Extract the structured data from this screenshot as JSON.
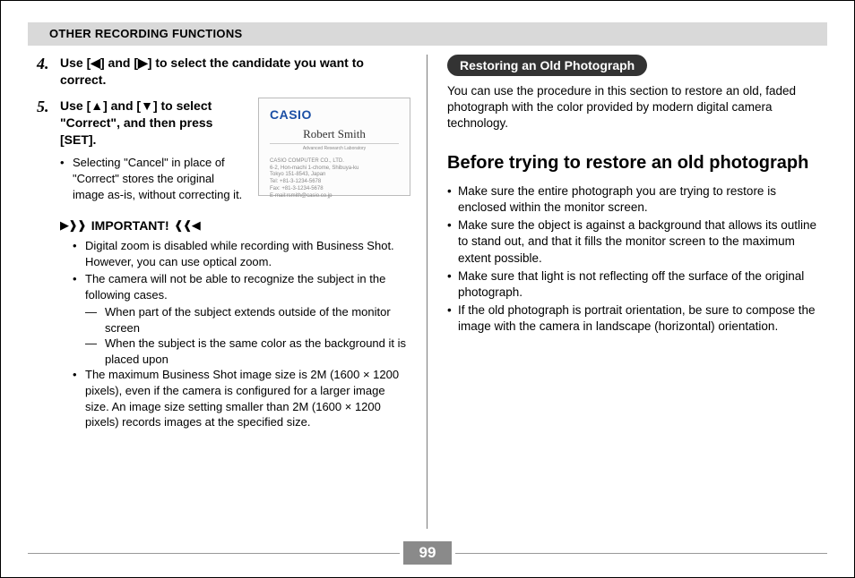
{
  "header": "OTHER RECORDING FUNCTIONS",
  "steps": {
    "s4": {
      "num": "4.",
      "text": "Use [◀] and [▶] to select the candidate you want to correct."
    },
    "s5": {
      "num": "5.",
      "text": "Use [▲] and [▼] to select \"Correct\", and then press [SET].",
      "sub": "Selecting \"Cancel\" in place of \"Correct\" stores the original image as-is, without correcting it."
    }
  },
  "card": {
    "logo": "CASIO",
    "name": "Robert Smith",
    "subtitle": "Advanced Research Laboratory",
    "lines": [
      "CASIO COMPUTER CO., LTD.",
      "6-2, Hon-machi 1-chome, Shibuya-ku",
      "Tokyo 151-8543, Japan",
      "Tel: +81-3-1234-5678",
      "Fax: +81-3-1234-5678",
      "E-mail:rsmith@casio.co.jp"
    ]
  },
  "important": {
    "label": "IMPORTANT!",
    "b1": "Digital zoom is disabled while recording with Business Shot. However, you can use optical zoom.",
    "b2": "The camera will not be able to recognize the subject in the following cases.",
    "d1": "When part of the subject extends outside of the monitor screen",
    "d2": "When the subject is the same color as the background it is placed upon",
    "b3": "The maximum Business Shot image size is 2M (1600 × 1200 pixels), even if the camera is configured for a larger image size. An image size setting smaller than 2M (1600 × 1200 pixels) records images at the specified size."
  },
  "right": {
    "pill": "Restoring an Old Photograph",
    "intro": "You can use the procedure in this section to restore an old, faded photograph with the color provided by modern digital camera technology.",
    "h2": "Before trying to restore an old photograph",
    "b1": "Make sure the entire photograph you are trying to restore is enclosed within the monitor screen.",
    "b2": "Make sure the object is against a background that allows its outline to stand out, and that it fills the monitor screen to the maximum extent possible.",
    "b3": "Make sure that light is not reflecting off the surface of the original photograph.",
    "b4": "If the old photograph is portrait orientation, be sure to compose the image with the camera in landscape (horizontal) orientation."
  },
  "page_number": "99"
}
